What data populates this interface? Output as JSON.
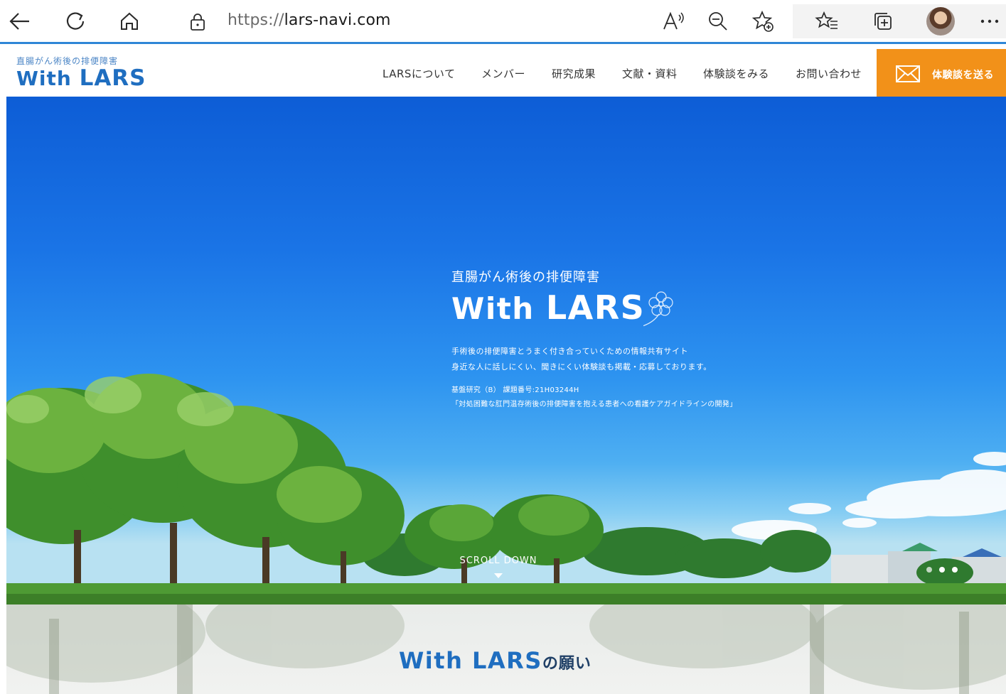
{
  "browser": {
    "url_scheme": "https://",
    "url_host": "lars-navi.com",
    "icons": [
      "back-arrow-icon",
      "refresh-icon",
      "home-icon",
      "lock-icon",
      "read-aloud-icon",
      "zoom-out-icon",
      "add-favorite-icon",
      "favorites-icon",
      "collections-icon",
      "profile-avatar",
      "more-icon"
    ]
  },
  "site": {
    "logo_sub": "直腸がん術後の排便障害",
    "logo_with": "With",
    "logo_lars": "LARS",
    "nav": [
      "LARSについて",
      "メンバー",
      "研究成果",
      "文献・資料",
      "体験談をみる",
      "お問い合わせ"
    ],
    "send_label": "体験談を送る",
    "accent_color": "#f29119",
    "brand_color": "#1f6ec0"
  },
  "hero": {
    "sub": "直腸がん術後の排便障害",
    "title_with": "With",
    "title_lars": "LARS",
    "desc_line1": "手術後の排便障害とうまく付き合っていくための情報共有サイト",
    "desc_line2": "身近な人に話しにくい、聞きにくい体験談も掲載・応募しております。",
    "grant_line1": "基盤研究（B） 課題番号:21H03244H",
    "grant_line2": "「対処困難な肛門温存術後の排便障害を抱える患者への看護ケアガイドラインの開発」",
    "scroll_label": "SCROLL DOWN",
    "slide_count": 3
  },
  "wish": {
    "title_main": "With LARS",
    "title_suffix": "の願い"
  }
}
